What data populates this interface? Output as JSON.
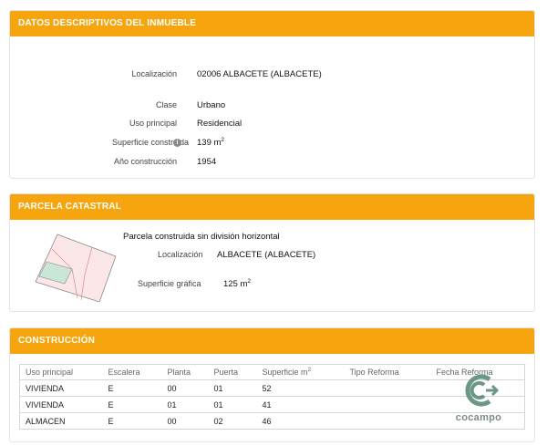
{
  "descriptivos": {
    "header": "DATOS DESCRIPTIVOS DEL INMUEBLE",
    "localizacion_label": "Localización",
    "localizacion_value": "02006 ALBACETE (ALBACETE)",
    "clase_label": "Clase",
    "clase_value": "Urbano",
    "uso_label": "Uso principal",
    "uso_value": "Residencial",
    "superficie_label": "Superficie construida",
    "superficie_value": "139 m",
    "superficie_unit_sup": "2",
    "anio_label": "Año construcción",
    "anio_value": "1954"
  },
  "parcela": {
    "header": "PARCELA CATASTRAL",
    "title": "Parcela construida sin división horizontal",
    "localizacion_label": "Localización",
    "localizacion_value": "ALBACETE (ALBACETE)",
    "superficie_label": "Superficie gráfica",
    "superficie_value": "125 m",
    "superficie_unit_sup": "2"
  },
  "construccion": {
    "header": "CONSTRUCCIÓN",
    "columns": [
      "Uso principal",
      "Escalera",
      "Planta",
      "Puerta",
      "Superficie m",
      "Tipo Reforma",
      "Fecha Reforma"
    ],
    "superficie_col_sup": "2",
    "rows": [
      [
        "VIVIENDA",
        "E",
        "00",
        "01",
        "52",
        "",
        ""
      ],
      [
        "VIVIENDA",
        "E",
        "01",
        "01",
        "41",
        "",
        ""
      ],
      [
        "ALMACEN",
        "E",
        "00",
        "02",
        "46",
        "",
        ""
      ]
    ]
  },
  "watermark": {
    "text": "cocampo"
  },
  "colors": {
    "header_bg": "#f6a50f",
    "parcel_fill_pink": "#fbe6e8",
    "parcel_fill_green": "#c9e6d6"
  }
}
